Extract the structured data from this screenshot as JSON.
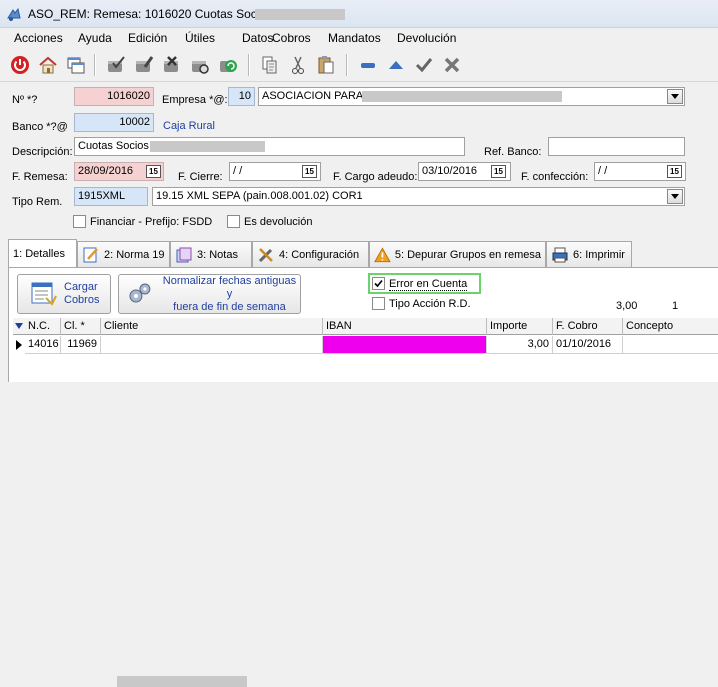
{
  "window": {
    "title": "ASO_REM: Remesa: 1016020 Cuotas Socios"
  },
  "menu": [
    "Acciones",
    "Ayuda",
    "Edición",
    "Útiles",
    "Datos",
    "Cobros",
    "Mandatos",
    "Devolución"
  ],
  "toolbar": {
    "icons": [
      "power-icon",
      "home-icon",
      "windows-icon",
      "check-pot-icon",
      "edit-pot-icon",
      "delete-pot-icon",
      "search-pot-icon",
      "refresh-pot-icon",
      "copy-icon",
      "cut-icon",
      "paste-icon",
      "minus-icon",
      "up-icon",
      "check-icon",
      "close-icon"
    ]
  },
  "form": {
    "numero_label": "Nº *?",
    "numero_value": "1016020",
    "empresa_label": "Empresa *@:",
    "empresa_code": "10",
    "empresa_name": "ASOCIACION PARA",
    "banco_label": "Banco *?@",
    "banco_code": "10002",
    "banco_name": "Caja Rural",
    "descripcion_label": "Descripción:",
    "descripcion_value": "Cuotas Socios",
    "ref_banco_label": "Ref. Banco:",
    "ref_banco_value": "",
    "f_remesa_label": "F. Remesa:",
    "f_remesa_value": "28/09/2016",
    "f_cierre_label": "F. Cierre:",
    "f_cierre_value": " / /",
    "f_cargo_label": "F. Cargo adeudo:",
    "f_cargo_value": "03/10/2016",
    "f_confeccion_label": "F. confección:",
    "f_confeccion_value": " / /",
    "tipo_rem_label": "Tipo Rem.",
    "tipo_rem_code": "1915XML",
    "tipo_rem_desc": "19.15 XML SEPA (pain.008.001.02) COR1",
    "financiar_label": "Financiar - Prefijo: FSDD",
    "es_devolucion_label": "Es devolución",
    "cal_glyph": "15"
  },
  "tabs": [
    {
      "label": "1: Detalles",
      "active": true
    },
    {
      "label": "2: Norma 19",
      "active": false
    },
    {
      "label": "3: Notas",
      "active": false
    },
    {
      "label": "4: Configuración",
      "active": false
    },
    {
      "label": "5: Depurar Grupos en remesa",
      "active": false
    },
    {
      "label": "6: Imprimir",
      "active": false
    }
  ],
  "detalles": {
    "cargar_cobros": [
      "Cargar",
      "Cobros"
    ],
    "normalizar": [
      "Normalizar fechas antiguas y",
      "fuera de fin de semana"
    ],
    "error_en_cuenta": "Error en Cuenta",
    "error_checked": true,
    "tipo_accion": "Tipo Acción R.D.",
    "total_importe": "3,00",
    "total_count": "1"
  },
  "grid": {
    "columns": [
      "N.C.",
      "Cl. *",
      "Cliente",
      "IBAN",
      "Importe",
      "F. Cobro",
      "Concepto"
    ],
    "rows": [
      {
        "nc": "14016",
        "cl": "11969",
        "cliente": "",
        "iban": "",
        "importe": "3,00",
        "fcobro": "01/10/2016",
        "concepto": ""
      }
    ]
  },
  "colors": {
    "pink_field": "#f6d1d1",
    "blue_field": "#d6e6f8",
    "iban_highlight": "#ee00ee",
    "focus_green": "#6bd36b"
  }
}
